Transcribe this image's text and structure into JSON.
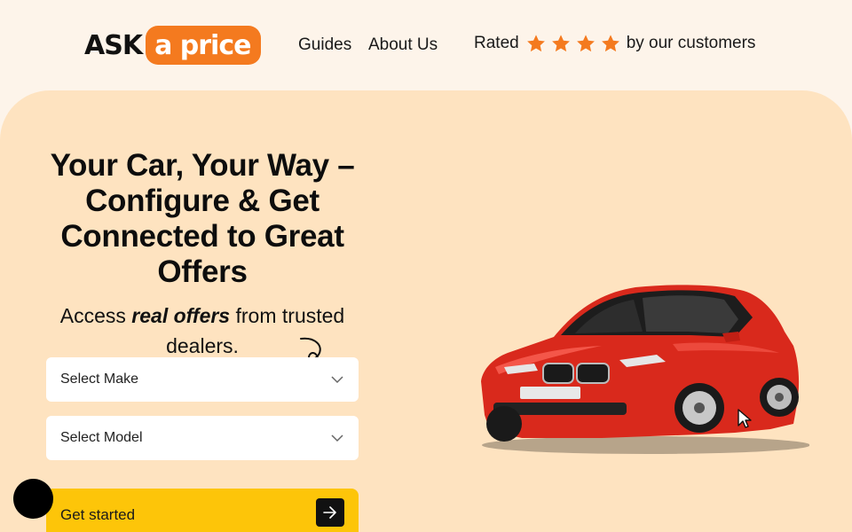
{
  "header": {
    "logo": {
      "ask": "ASK",
      "price": "a price"
    },
    "nav": [
      {
        "label": "Guides"
      },
      {
        "label": "About Us"
      }
    ],
    "rating": {
      "prefix": "Rated",
      "stars": 4,
      "suffix": "by our customers",
      "star_color": "#f47a1f"
    }
  },
  "hero": {
    "title": "Your Car, Your Way – Configure & Get Connected to Great Offers",
    "subtitle": {
      "before": "Access ",
      "emphasis": "real offers",
      "after": " from trusted dealers."
    },
    "make_select": {
      "label": "Select Make",
      "icon": "chevron-down-icon"
    },
    "model_select": {
      "label": "Select Model",
      "icon": "chevron-down-icon"
    },
    "cta": {
      "label": "Get started",
      "icon": "arrow-right-icon"
    }
  },
  "colors": {
    "page_bg": "#fdf4ea",
    "hero_bg": "#fee3c0",
    "brand_orange": "#f47a1f",
    "cta_yellow": "#fdc509"
  }
}
